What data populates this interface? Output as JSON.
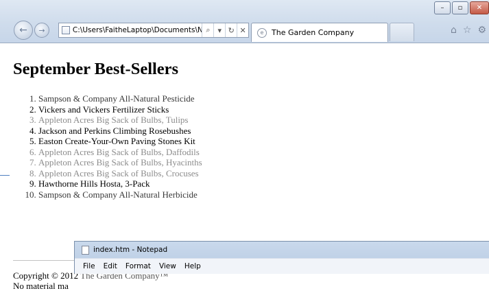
{
  "browser": {
    "address_url": "C:\\Users\\FaitheLaptop\\Documents\\N",
    "tab_title": "The Garden Company",
    "refresh_icon": "refresh-icon",
    "stop_icon": "stop-icon"
  },
  "page": {
    "heading": "September Best-Sellers",
    "items": [
      {
        "num": "1.",
        "text": "Sampson & Company All-Natural Pesticide"
      },
      {
        "num": "2.",
        "text": "Vickers and Vickers Fertilizer Sticks"
      },
      {
        "num": "3.",
        "text": "Appleton Acres Big Sack of Bulbs, Tulips"
      },
      {
        "num": "4.",
        "text": "Jackson and Perkins Climbing Rosebushes"
      },
      {
        "num": "5.",
        "text": "Easton Create-Your-Own Paving Stones Kit"
      },
      {
        "num": "6.",
        "text": "Appleton Acres Big Sack of Bulbs, Daffodils"
      },
      {
        "num": "7.",
        "text": "Appleton Acres Big Sack of Bulbs, Hyacinths"
      },
      {
        "num": "8.",
        "text": "Appleton Acres Big Sack of Bulbs, Crocuses"
      },
      {
        "num": "9.",
        "text": "Hawthorne Hills Hosta, 3-Pack"
      },
      {
        "num": "10.",
        "text": "Sampson & Company All-Natural Herbicide"
      }
    ],
    "copyright_prefix": "Copyright © 2012 ",
    "copyright_brand": "The Garden Company™",
    "material_line": "No material ma"
  },
  "notepad": {
    "title": "index.htm - Notepad",
    "menu": [
      "File",
      "Edit",
      "Format",
      "View",
      "Help"
    ]
  },
  "colors": {
    "dark_item": "#383838",
    "gray_item": "#8c8c8c"
  }
}
